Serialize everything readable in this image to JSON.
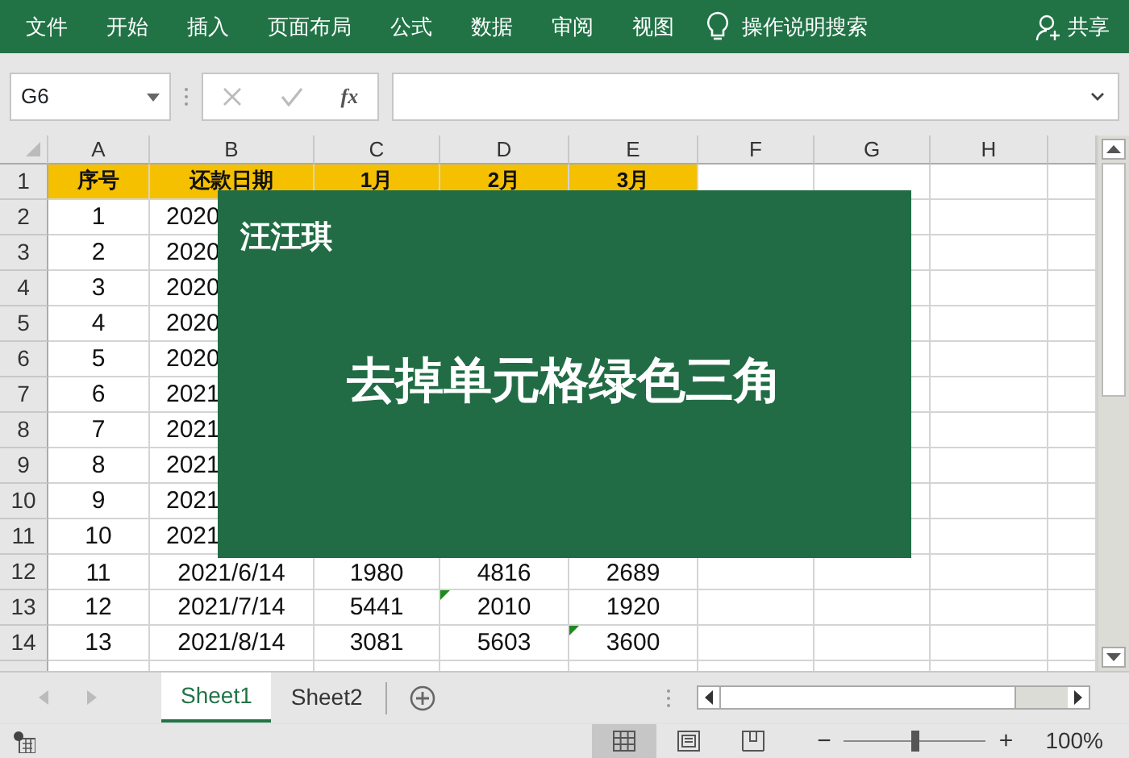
{
  "ribbon_tabs": [
    {
      "label": "文件"
    },
    {
      "label": "开始"
    },
    {
      "label": "插入"
    },
    {
      "label": "页面布局"
    },
    {
      "label": "公式"
    },
    {
      "label": "数据"
    },
    {
      "label": "审阅"
    },
    {
      "label": "视图"
    }
  ],
  "tell_me": {
    "placeholder": "操作说明搜索"
  },
  "share_button": "共享",
  "name_box": {
    "value": "G6"
  },
  "function_label": "fx",
  "columns": [
    "A",
    "B",
    "C",
    "D",
    "E",
    "F",
    "G",
    "H"
  ],
  "rows": [
    {
      "number": "1",
      "kind": "header",
      "cells": [
        {
          "text": "序号",
          "error_flag": false
        },
        {
          "text": "还款日期",
          "error_flag": false
        },
        {
          "text": "1月",
          "error_flag": false
        },
        {
          "text": "2月",
          "error_flag": false
        },
        {
          "text": "3月",
          "error_flag": false
        }
      ]
    },
    {
      "number": "2",
      "kind": "partial",
      "cells": [
        {
          "text": "1",
          "error_flag": false
        },
        {
          "text": "2020",
          "error_flag": false
        }
      ]
    },
    {
      "number": "3",
      "kind": "partial",
      "cells": [
        {
          "text": "2",
          "error_flag": false
        },
        {
          "text": "2020",
          "error_flag": false
        }
      ]
    },
    {
      "number": "4",
      "kind": "partial",
      "cells": [
        {
          "text": "3",
          "error_flag": false
        },
        {
          "text": "2020",
          "error_flag": false
        }
      ]
    },
    {
      "number": "5",
      "kind": "partial",
      "cells": [
        {
          "text": "4",
          "error_flag": false
        },
        {
          "text": "2020",
          "error_flag": false
        }
      ]
    },
    {
      "number": "6",
      "kind": "partial",
      "cells": [
        {
          "text": "5",
          "error_flag": false
        },
        {
          "text": "2020",
          "error_flag": false
        }
      ]
    },
    {
      "number": "7",
      "kind": "partial",
      "cells": [
        {
          "text": "6",
          "error_flag": false
        },
        {
          "text": "2021",
          "error_flag": false
        }
      ]
    },
    {
      "number": "8",
      "kind": "partial",
      "cells": [
        {
          "text": "7",
          "error_flag": false
        },
        {
          "text": "2021",
          "error_flag": false
        }
      ]
    },
    {
      "number": "9",
      "kind": "partial",
      "cells": [
        {
          "text": "8",
          "error_flag": false
        },
        {
          "text": "2021",
          "error_flag": false
        }
      ]
    },
    {
      "number": "10",
      "kind": "partial",
      "cells": [
        {
          "text": "9",
          "error_flag": false
        },
        {
          "text": "2021",
          "error_flag": false
        }
      ]
    },
    {
      "number": "11",
      "kind": "partial",
      "cells": [
        {
          "text": "10",
          "error_flag": false
        },
        {
          "text": "2021",
          "error_flag": false
        }
      ]
    },
    {
      "number": "12",
      "kind": "lower",
      "cells": [
        {
          "text": "11",
          "error_flag": false
        },
        {
          "text": "2021/6/14",
          "error_flag": false
        },
        {
          "text": "1980",
          "error_flag": false
        },
        {
          "text": "4816",
          "error_flag": false
        },
        {
          "text": "2689",
          "error_flag": false
        }
      ]
    },
    {
      "number": "13",
      "kind": "data",
      "cells": [
        {
          "text": "12",
          "error_flag": false
        },
        {
          "text": "2021/7/14",
          "error_flag": false
        },
        {
          "text": "5441",
          "error_flag": false
        },
        {
          "text": "2010",
          "error_flag": true
        },
        {
          "text": "1920",
          "error_flag": false
        }
      ]
    },
    {
      "number": "14",
      "kind": "data",
      "cells": [
        {
          "text": "13",
          "error_flag": false
        },
        {
          "text": "2021/8/14",
          "error_flag": false
        },
        {
          "text": "3081",
          "error_flag": false
        },
        {
          "text": "5603",
          "error_flag": false
        },
        {
          "text": "3600",
          "error_flag": true
        }
      ]
    }
  ],
  "overlay": {
    "author": "汪汪琪",
    "headline": "去掉单元格绿色三角"
  },
  "sheet_tabs": [
    {
      "label": "Sheet1",
      "selected": true
    },
    {
      "label": "Sheet2",
      "selected": false
    }
  ],
  "view_buttons": [
    {
      "kind": "normal",
      "selected": true
    },
    {
      "kind": "page_layout",
      "selected": false
    },
    {
      "kind": "page_break",
      "selected": false
    }
  ],
  "zoom": {
    "zoom_out": "−",
    "zoom_in": "+",
    "level": 0.5,
    "reading": "100%"
  }
}
